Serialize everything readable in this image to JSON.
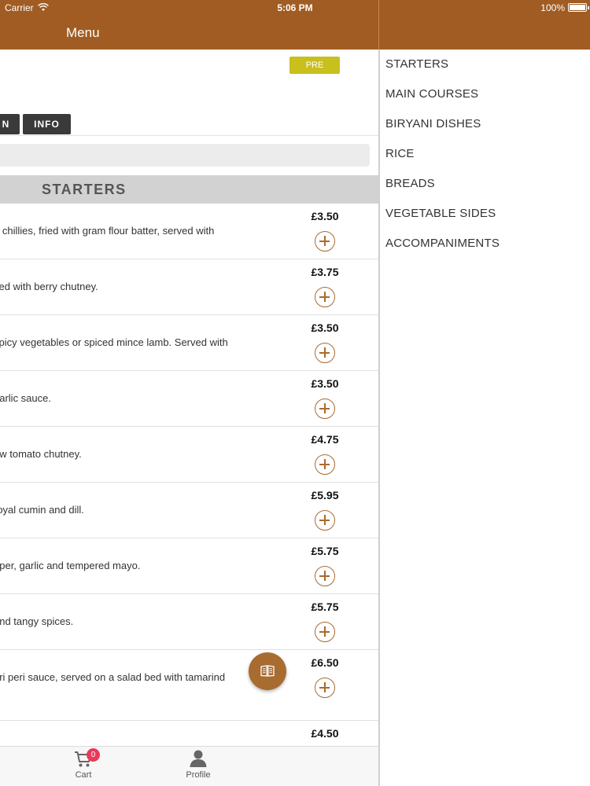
{
  "status_bar": {
    "carrier": "Carrier",
    "time": "5:06 PM",
    "battery": "100%"
  },
  "nav": {
    "title": "Menu"
  },
  "header": {
    "preorder_label": "PRE ORDER",
    "tabs": [
      {
        "label": "N"
      },
      {
        "label": "INFO"
      }
    ]
  },
  "section": {
    "title": "STARTERS"
  },
  "items": [
    {
      "desc": "n chillies, fried with gram flour batter, served with",
      "price": "£3.50"
    },
    {
      "desc": "ved with berry chutney.",
      "price": "£3.75"
    },
    {
      "desc": "spicy vegetables or spiced mince lamb. Served with",
      "price": "£3.50"
    },
    {
      "desc": "garlic sauce.",
      "price": "£3.50"
    },
    {
      "desc": "ow tomato chutney.",
      "price": "£4.75"
    },
    {
      "desc": "royal cumin and dill.",
      "price": "£5.95"
    },
    {
      "desc": "pper, garlic and tempered mayo.",
      "price": "£5.75"
    },
    {
      "desc": "and tangy spices.",
      "price": "£5.75"
    },
    {
      "desc": "eri peri sauce, served on a salad bed with tamarind",
      "price": "£6.50"
    },
    {
      "desc": "",
      "price": "£4.50"
    }
  ],
  "bottom_tabs": {
    "cart_label": "Cart",
    "cart_count": "0",
    "profile_label": "Profile"
  },
  "categories": [
    "STARTERS",
    "MAIN COURSES",
    "BIRYANI DISHES",
    "RICE",
    "BREADS",
    "VEGETABLE SIDES",
    "ACCOMPANIMENTS"
  ],
  "colors": {
    "brand": "#a05c22",
    "accent": "#a86b30",
    "preorder": "#c9c01d",
    "badge": "#e83a5a"
  }
}
